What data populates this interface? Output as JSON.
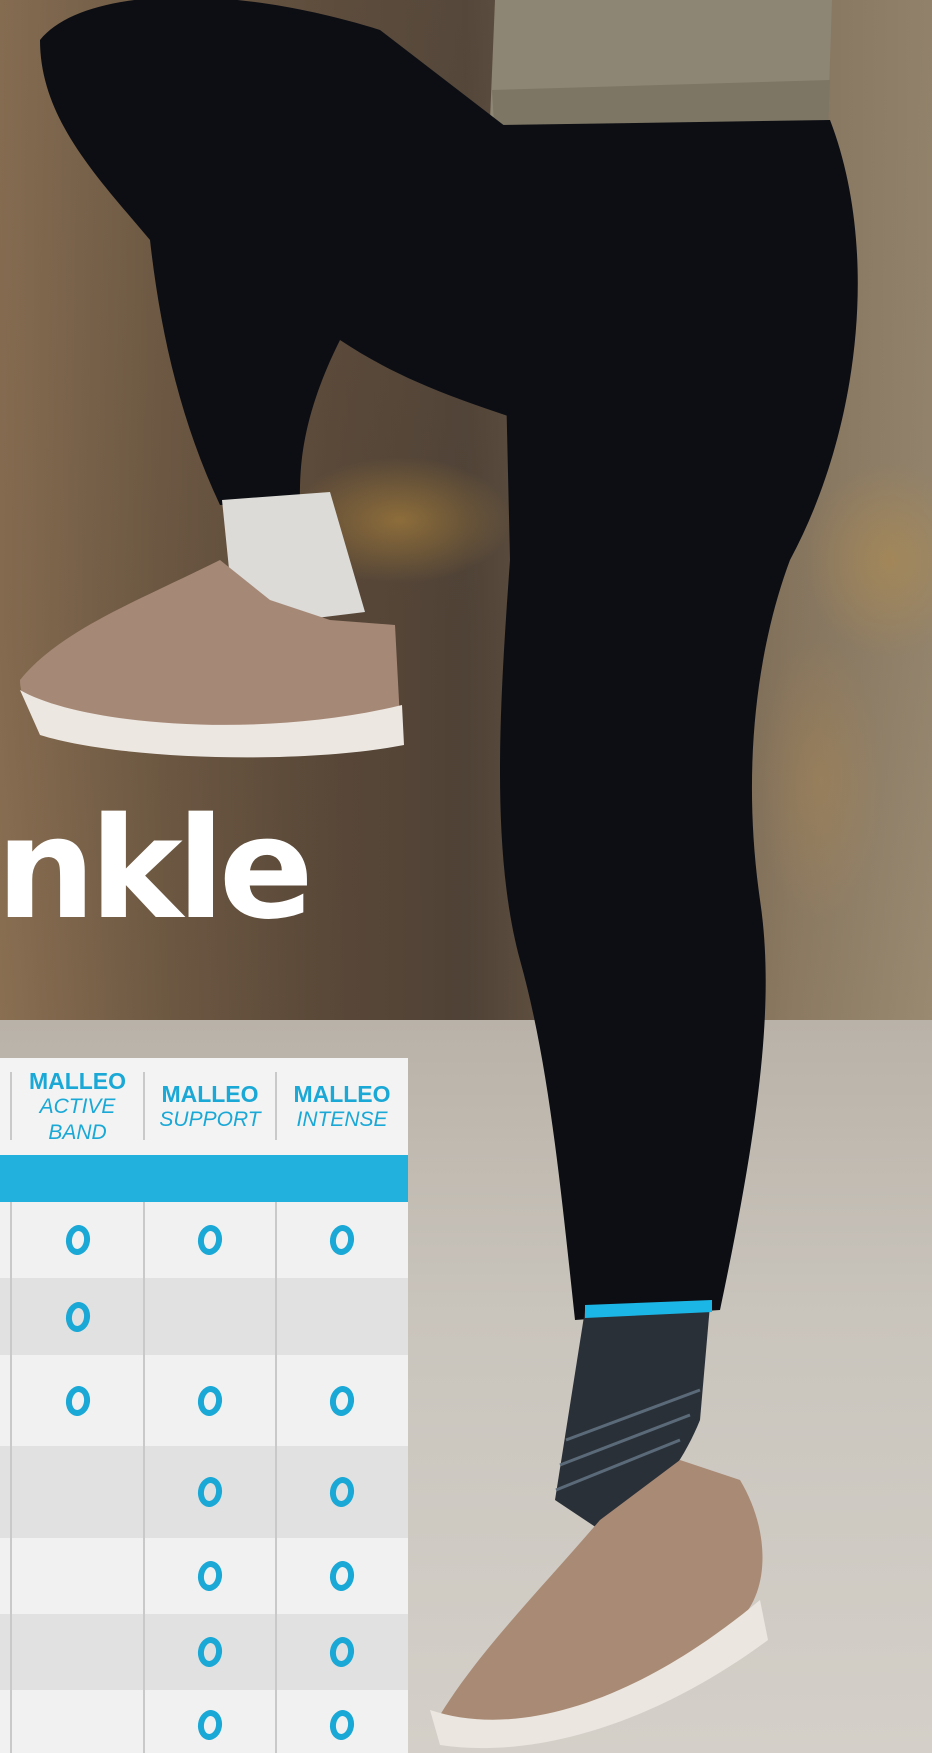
{
  "headline": "nkle",
  "table": {
    "columns": [
      {
        "name": "MALLEO",
        "variant_lines": [
          "ACTIVE",
          "BAND"
        ]
      },
      {
        "name": "MALLEO",
        "variant_lines": [
          "SUPPORT"
        ]
      },
      {
        "name": "MALLEO",
        "variant_lines": [
          "INTENSE"
        ]
      }
    ],
    "rows": [
      [
        true,
        true,
        true
      ],
      [
        true,
        false,
        false
      ],
      [
        true,
        true,
        true
      ],
      [
        false,
        true,
        true
      ],
      [
        false,
        true,
        true
      ],
      [
        false,
        true,
        true
      ],
      [
        false,
        true,
        true
      ]
    ]
  },
  "colors": {
    "accent": "#1aa8d6",
    "bar": "#22b1dd",
    "row_light": "#f1f1f1",
    "row_dark": "#e1e1e1",
    "headline": "#ffffff"
  },
  "icons": {
    "check_mark": "ring-mark-icon"
  }
}
